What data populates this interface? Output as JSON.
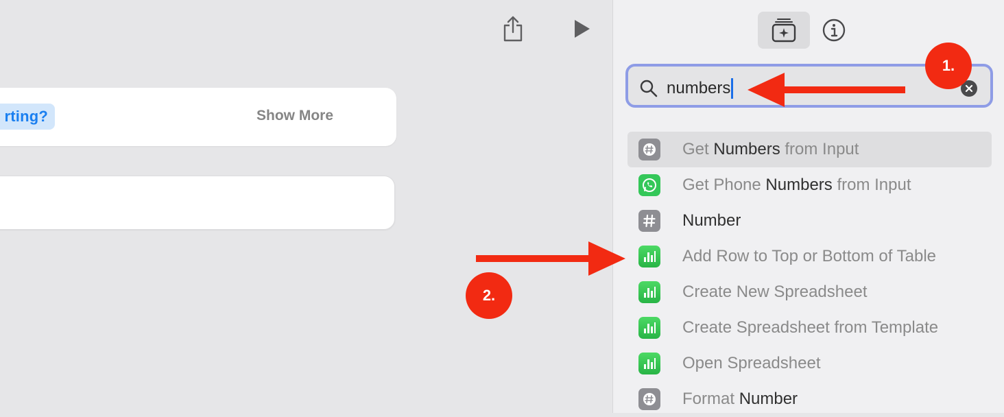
{
  "toolbar": {
    "share_icon": "share-icon",
    "run_icon": "play-icon"
  },
  "editor": {
    "starting_chip": "rting?",
    "show_more": "Show More"
  },
  "panel": {
    "library_tab_icon": "action-library-icon",
    "info_tab_icon": "info-icon",
    "search": {
      "value": "numbers",
      "placeholder": "",
      "clear_icon": "clear-icon"
    },
    "results": [
      {
        "pre": "Get ",
        "match": "Numbers",
        "post": " from Input",
        "icon": "number-gray-icon",
        "selected": true
      },
      {
        "pre": "Get Phone ",
        "match": "Numbers",
        "post": " from Input",
        "icon": "phone-green-icon",
        "selected": false
      },
      {
        "pre": "",
        "match": "Number",
        "post": "",
        "icon": "hash-icon",
        "selected": false
      },
      {
        "pre": "Add Row to Top or Bottom of Table",
        "match": "",
        "post": "",
        "icon": "numbers-app-icon",
        "selected": false
      },
      {
        "pre": "Create New Spreadsheet",
        "match": "",
        "post": "",
        "icon": "numbers-app-icon",
        "selected": false
      },
      {
        "pre": "Create Spreadsheet from Template",
        "match": "",
        "post": "",
        "icon": "numbers-app-icon",
        "selected": false
      },
      {
        "pre": "Open Spreadsheet",
        "match": "",
        "post": "",
        "icon": "numbers-app-icon",
        "selected": false
      },
      {
        "pre": "Format ",
        "match": "Number",
        "post": "",
        "icon": "number-gray-icon",
        "selected": false
      }
    ]
  },
  "annotations": {
    "badge1": "1.",
    "badge2": "2."
  },
  "colors": {
    "annotation_red": "#f22a12",
    "search_focus": "#8e9ce6",
    "chip_blue": "#1a7ff0",
    "numbers_green": "#34c759"
  }
}
